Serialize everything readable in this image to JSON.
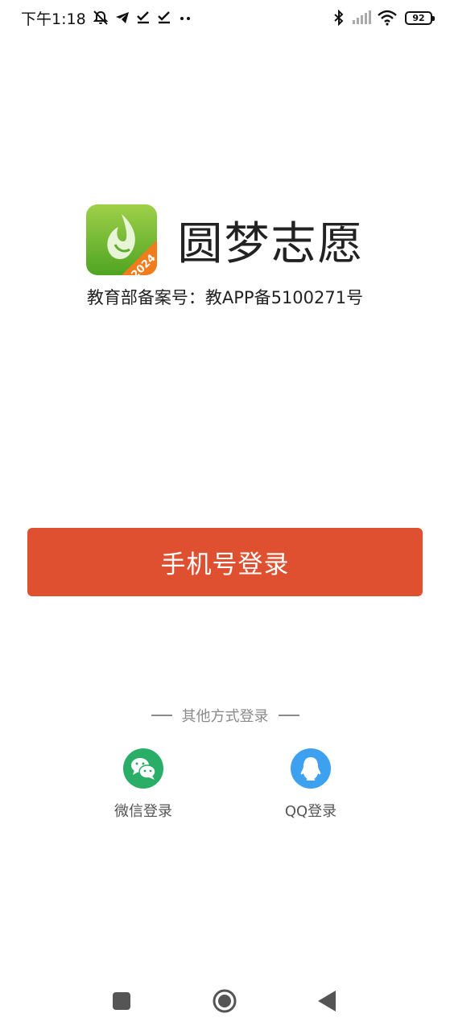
{
  "status_bar": {
    "time": "下午1:18",
    "battery": "92"
  },
  "brand": {
    "app_name": "圆梦志愿",
    "logo_badge": "2024",
    "record_number": "教育部备案号：教APP备5100271号"
  },
  "login": {
    "phone_login_label": "手机号登录",
    "other_methods_label": "其他方式登录",
    "wechat_label": "微信登录",
    "qq_label": "QQ登录"
  },
  "colors": {
    "primary_button": "#de502f",
    "wechat_green": "#2aae67",
    "qq_blue": "#3ea1f0",
    "logo_green": "#7cc23a"
  },
  "icons": {
    "status_left": [
      "mute-bell-icon",
      "telegram-icon",
      "check-download-icon",
      "check-download-icon",
      "more-dots-icon"
    ],
    "status_right": [
      "bluetooth-icon",
      "signal-icon",
      "wifi-icon",
      "battery-icon"
    ],
    "nav": [
      "recents-square-icon",
      "home-circle-icon",
      "back-triangle-icon"
    ]
  }
}
